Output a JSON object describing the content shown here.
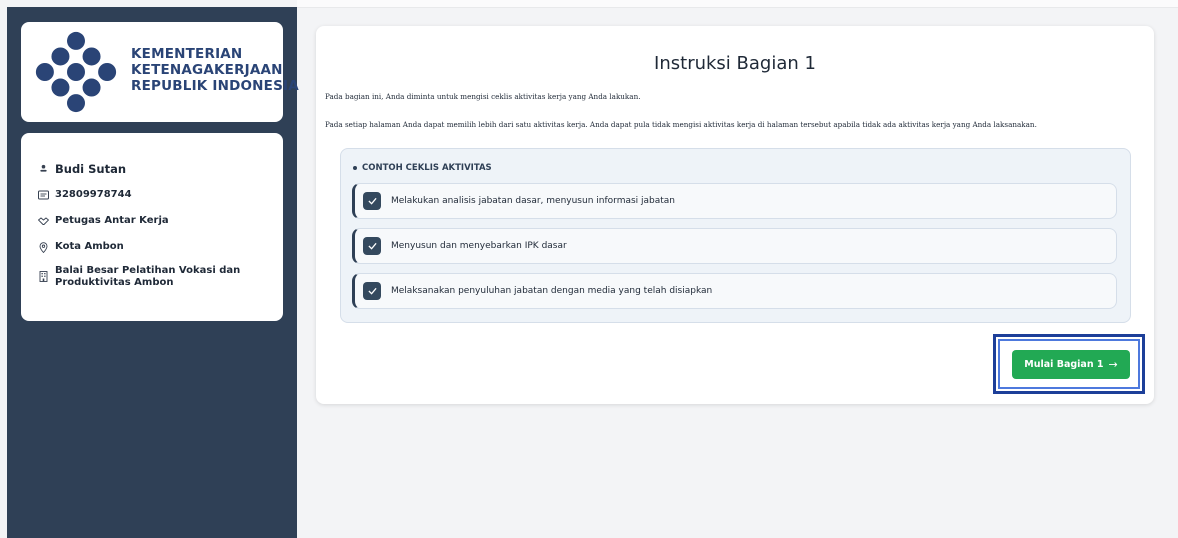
{
  "sidebar": {
    "logo": {
      "line1": "KEMENTERIAN",
      "line2": "KETENAGAKERJAAN",
      "line3": "REPUBLIK INDONESIA"
    },
    "user": {
      "name": "Budi Sutan",
      "id_number": "32809978744",
      "role": "Petugas Antar Kerja",
      "city": "Kota Ambon",
      "institution": "Balai Besar Pelatihan Vokasi dan Produktivitas Ambon"
    }
  },
  "main": {
    "title": "Instruksi Bagian 1",
    "paragraph1": "Pada bagian ini, Anda diminta untuk mengisi ceklis aktivitas kerja yang Anda lakukan.",
    "paragraph2": "Pada setiap halaman Anda dapat memilih lebih dari satu aktivitas kerja. Anda dapat pula tidak mengisi aktivitas kerja di halaman tersebut apabila tidak ada aktivitas kerja yang Anda laksanakan.",
    "example": {
      "heading": "CONTOH CEKLIS AKTIVITAS",
      "items": [
        {
          "label": "Melakukan analisis jabatan dasar, menyusun informasi jabatan",
          "checked": true
        },
        {
          "label": "Menyusun dan menyebarkan IPK dasar",
          "checked": true
        },
        {
          "label": "Melaksanakan penyuluhan jabatan dengan media yang telah disiapkan",
          "checked": true
        }
      ]
    },
    "start_button": {
      "label": "Mulai Bagian 1",
      "arrow": "→"
    }
  },
  "colors": {
    "sidebar_bg": "#2f4056",
    "logo_text": "#2a4476",
    "primary_button": "#22a954",
    "focus_ring": "#1d3f99"
  },
  "icons": [
    "user-icon",
    "id-card-icon",
    "handshake-icon",
    "location-pin-icon",
    "building-icon",
    "check-icon",
    "arrow-right-icon"
  ]
}
